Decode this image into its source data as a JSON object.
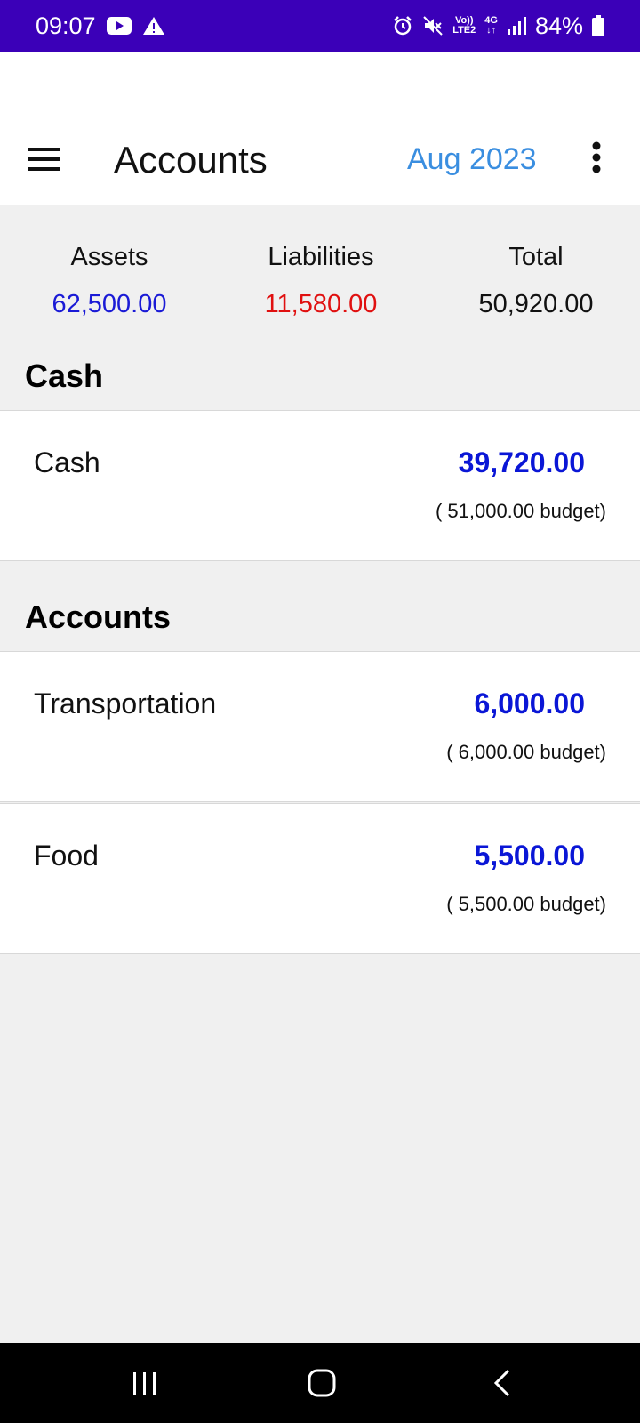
{
  "status_bar": {
    "time": "09:07",
    "network_top": "Vo))",
    "network_bottom": "LTE2",
    "network_type": "4G",
    "battery": "84%",
    "icons": [
      "youtube-icon",
      "warning-icon",
      "alarm-icon",
      "mute-icon",
      "volte-icon",
      "data-arrows-icon",
      "signal-icon",
      "battery-icon"
    ]
  },
  "app_bar": {
    "title": "Accounts",
    "month": "Aug 2023"
  },
  "summary": {
    "assets_label": "Assets",
    "assets_value": "62,500.00",
    "liabilities_label": "Liabilities",
    "liabilities_value": "11,580.00",
    "total_label": "Total",
    "total_value": "50,920.00"
  },
  "sections": [
    {
      "title": "Cash",
      "accounts": [
        {
          "name": "Cash",
          "amount": "39,720.00",
          "budget": "( 51,000.00 budget)"
        }
      ]
    },
    {
      "title": "Accounts",
      "accounts": [
        {
          "name": "Transportation",
          "amount": "6,000.00",
          "budget": "( 6,000.00 budget)"
        },
        {
          "name": "Food",
          "amount": "5,500.00",
          "budget": "( 5,500.00 budget)"
        }
      ]
    }
  ],
  "colors": {
    "status_bar": "#3b00b8",
    "assets": "#1a1ad6",
    "liabilities": "#e01010",
    "amount": "#0a16d6",
    "month": "#3a8ee0"
  }
}
